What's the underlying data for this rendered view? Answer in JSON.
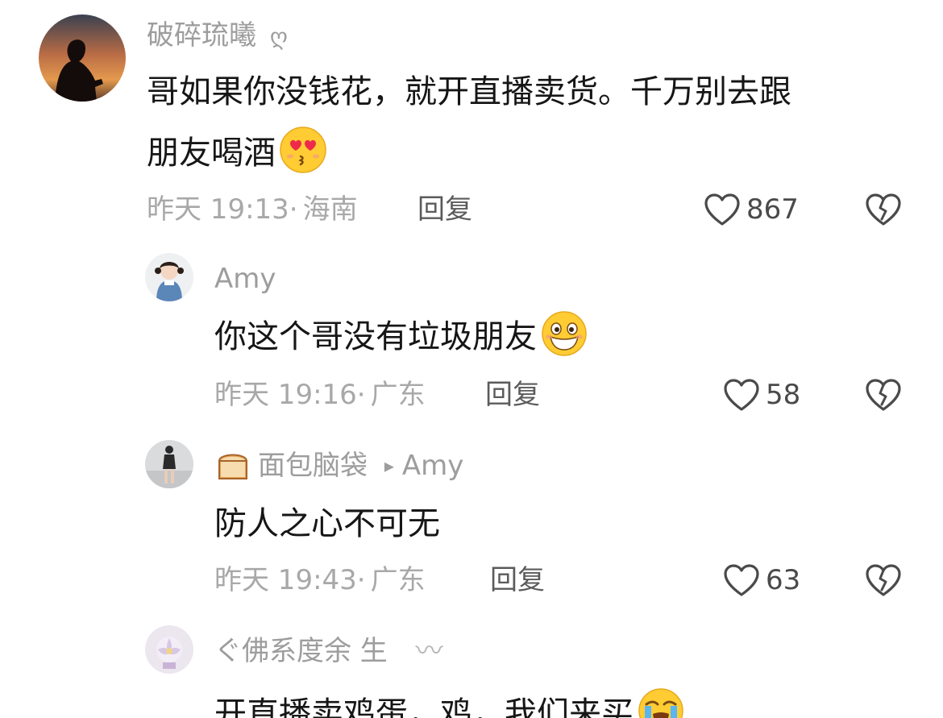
{
  "comments": [
    {
      "username": "破碎琉曦",
      "name_suffix": "ღ",
      "text_line1": "哥如果你没钱花，就开直播卖货。千万别去跟",
      "text_line2": "朋友喝酒",
      "emoji": "heart-eyes-kiss-emoji",
      "time": "昨天 19:13",
      "location": "海南",
      "reply_label": "回复",
      "likes": "867"
    },
    {
      "username": "Amy",
      "text_line1": "你这个哥没有垃圾朋友",
      "emoji": "grinning-squint-emoji",
      "time": "昨天 19:16",
      "location": "广东",
      "reply_label": "回复",
      "likes": "58"
    },
    {
      "username_emoji": "bread-emoji",
      "username": "面包脑袋",
      "reply_to_arrow": "▸",
      "reply_to": "Amy",
      "text_line1": "防人之心不可无",
      "time": "昨天 19:43",
      "location": "广东",
      "reply_label": "回复",
      "likes": "63"
    },
    {
      "username": "ぐ佛系度余 生",
      "name_suffix": "〰",
      "text_line1": "开直播卖鸡蛋，鸡，我们来买"
    }
  ],
  "colors": {
    "username": "#9d9d9d",
    "meta": "#a8a8a8",
    "reply": "#5b5b5b",
    "text": "#161616",
    "icon": "#4a4a4a"
  },
  "separator": "·"
}
